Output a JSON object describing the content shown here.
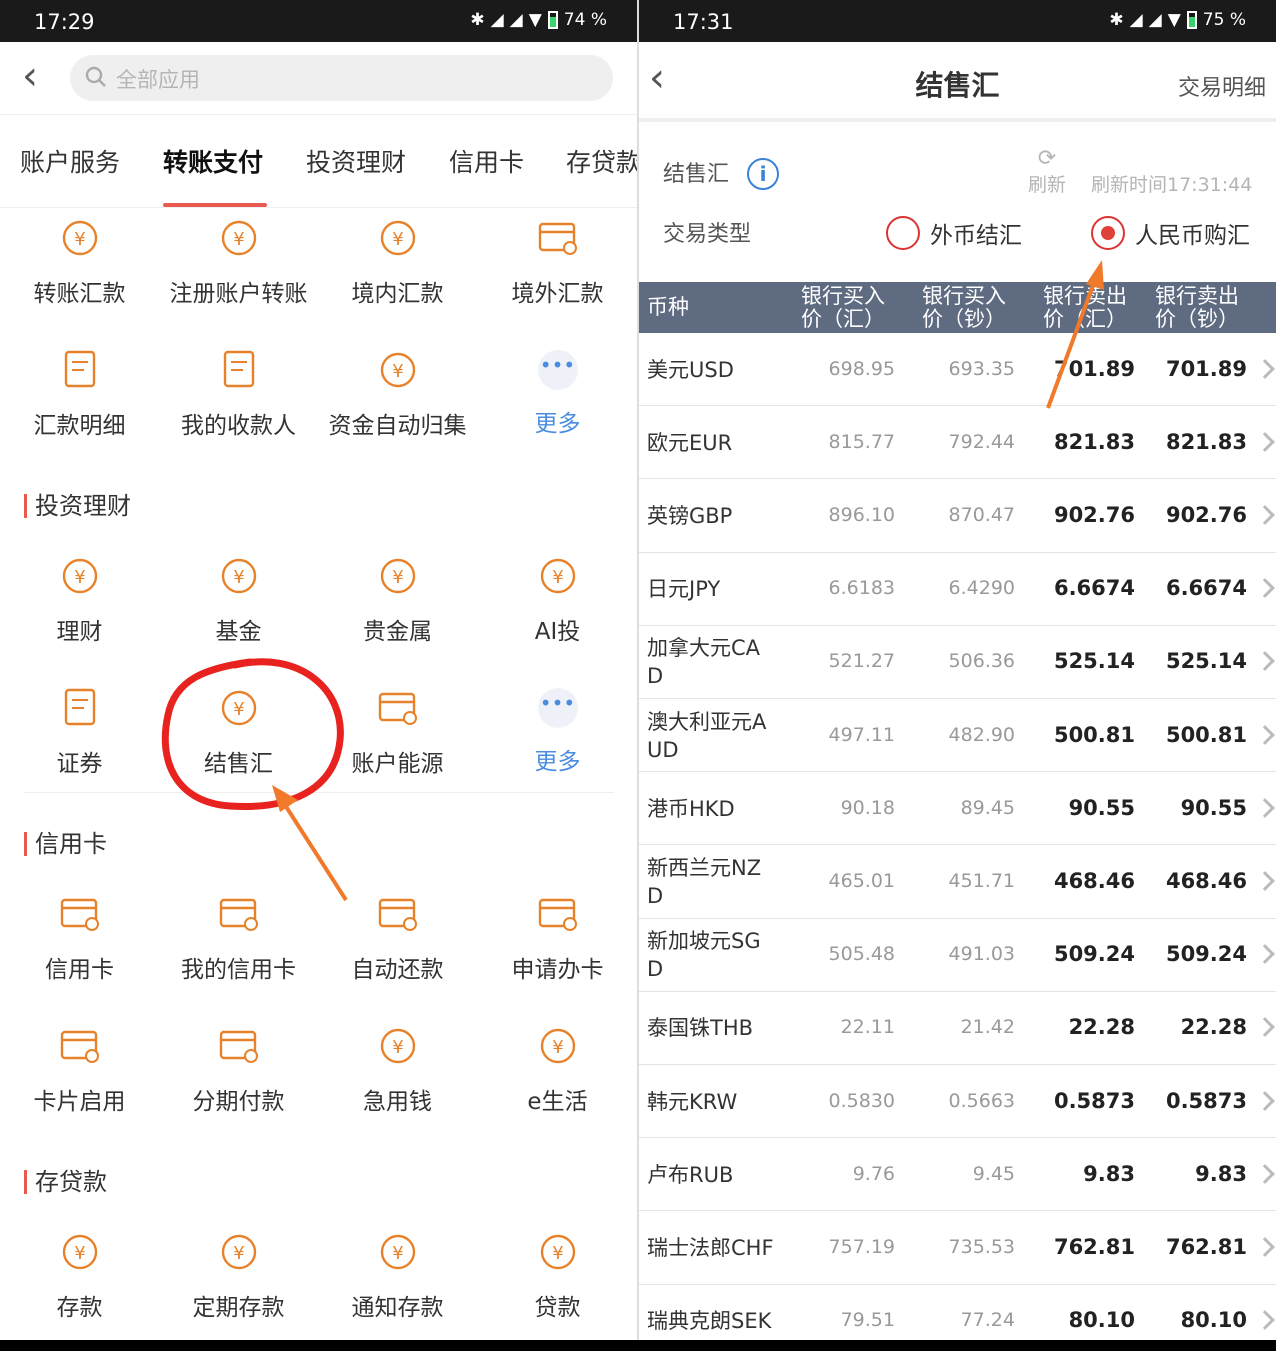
{
  "left": {
    "status": {
      "time": "17:29",
      "battery": "74 %"
    },
    "search_placeholder": "全部应用",
    "tabs": [
      "账户服务",
      "转账支付",
      "投资理财",
      "信用卡",
      "存贷款"
    ],
    "transfer_items": [
      {
        "label": "转账汇款",
        "icon": "yuan-arrows-icon"
      },
      {
        "label": "注册账户转账",
        "icon": "account-transfer-icon"
      },
      {
        "label": "境内汇款",
        "icon": "domestic-remit-icon"
      },
      {
        "label": "境外汇款",
        "icon": "overseas-card-icon"
      },
      {
        "label": "汇款明细",
        "icon": "remit-detail-icon"
      },
      {
        "label": "我的收款人",
        "icon": "payee-icon"
      },
      {
        "label": "资金自动归集",
        "icon": "fund-collect-icon"
      },
      {
        "label": "更多",
        "icon": "more-icon"
      }
    ],
    "sections": {
      "invest": "投资理财",
      "credit": "信用卡",
      "deposit": "存贷款"
    },
    "invest_items": [
      {
        "label": "理财",
        "icon": "wealth-flower-icon"
      },
      {
        "label": "基金",
        "icon": "fund-chart-icon"
      },
      {
        "label": "贵金属",
        "icon": "gold-bars-icon"
      },
      {
        "label": "AI投",
        "icon": "ai-invest-icon"
      },
      {
        "label": "证券",
        "icon": "securities-chart-icon"
      },
      {
        "label": "结售汇",
        "icon": "fx-exchange-icon"
      },
      {
        "label": "账户能源",
        "icon": "account-energy-icon"
      },
      {
        "label": "更多",
        "icon": "more-icon"
      }
    ],
    "credit_items": [
      {
        "label": "信用卡",
        "icon": "credit-card-icon"
      },
      {
        "label": "我的信用卡",
        "icon": "my-card-icon"
      },
      {
        "label": "自动还款",
        "icon": "auto-repay-icon"
      },
      {
        "label": "申请办卡",
        "icon": "apply-card-icon"
      },
      {
        "label": "卡片启用",
        "icon": "card-activate-icon"
      },
      {
        "label": "分期付款",
        "icon": "installment-icon"
      },
      {
        "label": "急用钱",
        "icon": "cash-icon"
      },
      {
        "label": "e生活",
        "icon": "e-life-icon"
      }
    ],
    "deposit_items": [
      {
        "label": "存款",
        "icon": "piggy-bank-icon"
      },
      {
        "label": "定期存款",
        "icon": "fixed-deposit-icon"
      },
      {
        "label": "通知存款",
        "icon": "notice-deposit-icon"
      },
      {
        "label": "贷款",
        "icon": "loan-icon"
      }
    ]
  },
  "right": {
    "status": {
      "time": "17:31",
      "battery": "75 %"
    },
    "title": "结售汇",
    "detail_link": "交易明细",
    "section_label": "结售汇",
    "refresh_label": "刷新",
    "refresh_time": "刷新时间17:31:44",
    "type_label": "交易类型",
    "options": [
      "外币结汇",
      "人民币购汇"
    ],
    "selected_option": "人民币购汇",
    "headers": [
      "币种",
      "银行买入价（汇）",
      "银行买入价（钞）",
      "银行卖出价（汇）",
      "银行卖出价（钞）"
    ],
    "rows": [
      {
        "name": "美元USD",
        "buy_fx": "698.95",
        "buy_cash": "693.35",
        "sell_fx": "701.89",
        "sell_cash": "701.89"
      },
      {
        "name": "欧元EUR",
        "buy_fx": "815.77",
        "buy_cash": "792.44",
        "sell_fx": "821.83",
        "sell_cash": "821.83"
      },
      {
        "name": "英镑GBP",
        "buy_fx": "896.10",
        "buy_cash": "870.47",
        "sell_fx": "902.76",
        "sell_cash": "902.76"
      },
      {
        "name": "日元JPY",
        "buy_fx": "6.6183",
        "buy_cash": "6.4290",
        "sell_fx": "6.6674",
        "sell_cash": "6.6674"
      },
      {
        "name": "加拿大元CAD",
        "buy_fx": "521.27",
        "buy_cash": "506.36",
        "sell_fx": "525.14",
        "sell_cash": "525.14"
      },
      {
        "name": "澳大利亚元AUD",
        "buy_fx": "497.11",
        "buy_cash": "482.90",
        "sell_fx": "500.81",
        "sell_cash": "500.81"
      },
      {
        "name": "港币HKD",
        "buy_fx": "90.18",
        "buy_cash": "89.45",
        "sell_fx": "90.55",
        "sell_cash": "90.55"
      },
      {
        "name": "新西兰元NZD",
        "buy_fx": "465.01",
        "buy_cash": "451.71",
        "sell_fx": "468.46",
        "sell_cash": "468.46"
      },
      {
        "name": "新加坡元SGD",
        "buy_fx": "505.48",
        "buy_cash": "491.03",
        "sell_fx": "509.24",
        "sell_cash": "509.24"
      },
      {
        "name": "泰国铢THB",
        "buy_fx": "22.11",
        "buy_cash": "21.42",
        "sell_fx": "22.28",
        "sell_cash": "22.28"
      },
      {
        "name": "韩元KRW",
        "buy_fx": "0.5830",
        "buy_cash": "0.5663",
        "sell_fx": "0.5873",
        "sell_cash": "0.5873"
      },
      {
        "name": "卢布RUB",
        "buy_fx": "9.76",
        "buy_cash": "9.45",
        "sell_fx": "9.83",
        "sell_cash": "9.83"
      },
      {
        "name": "瑞士法郎CHF",
        "buy_fx": "757.19",
        "buy_cash": "735.53",
        "sell_fx": "762.81",
        "sell_cash": "762.81"
      },
      {
        "name": "瑞典克朗SEK",
        "buy_fx": "79.51",
        "buy_cash": "77.24",
        "sell_fx": "80.10",
        "sell_cash": "80.10"
      }
    ]
  },
  "colors": {
    "accent": "#e85a4f",
    "icon_orange": "#e8822a",
    "header_bg": "#5f6b80",
    "annotation_red": "#e8231f",
    "annotation_orange": "#f07a2a",
    "link_blue": "#4a8de0"
  }
}
